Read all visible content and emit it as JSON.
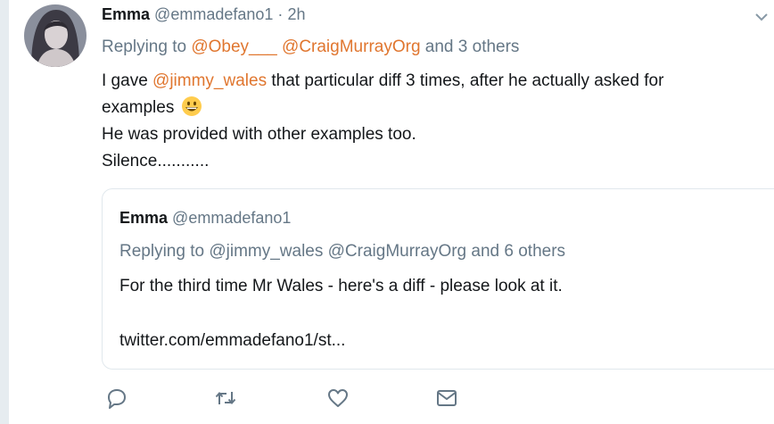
{
  "tweet": {
    "name": "Emma",
    "handle": "@emmadefano1",
    "separator": "·",
    "time": "2h",
    "replying_prefix": "Replying to",
    "replying_mentions": [
      "@Obey___",
      "@CraigMurrayOrg"
    ],
    "replying_suffix": "and 3 others",
    "body": {
      "line1_pre": "I gave",
      "line1_mention": "@jimmy_wales",
      "line1_post": "that particular diff 3 times, after he actually asked for",
      "line2": "examples",
      "line2_emoji": "grinning-face-emoji",
      "line3": "He was provided with other examples too.",
      "line4": "Silence..........."
    }
  },
  "quoted_tweet": {
    "name": "Emma",
    "handle": "@emmadefano1",
    "replying": "Replying to @jimmy_wales @CraigMurrayOrg and 6 others",
    "text": "For the third time Mr Wales - here's a diff - please look at it.",
    "link": "twitter.com/emmadefano1/st..."
  },
  "actions": [
    "reply-icon",
    "retweet-icon",
    "like-icon",
    "direct-message-icon"
  ],
  "colors": {
    "accent_link": "#e0762f",
    "muted_text": "#657786",
    "border": "#e1e8ed",
    "background": "#e6ecf0"
  }
}
